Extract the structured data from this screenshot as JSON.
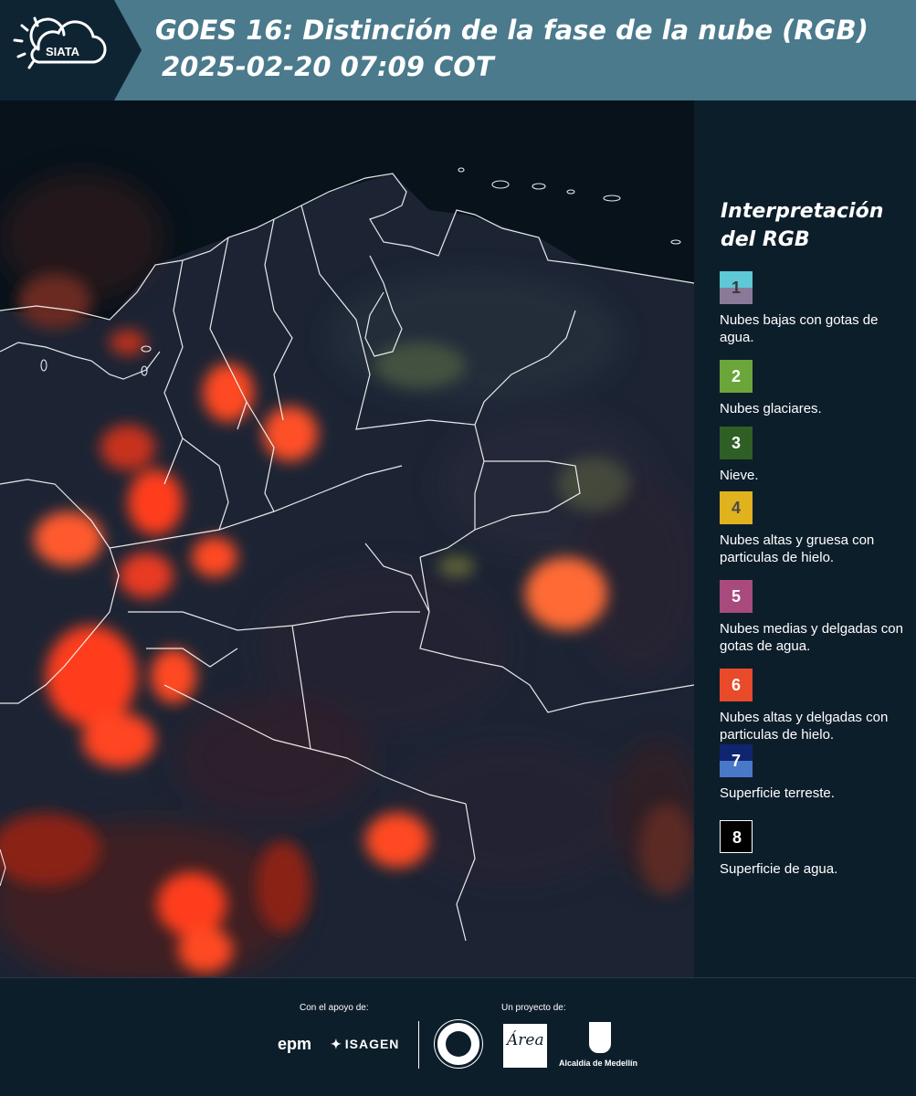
{
  "header": {
    "logo_text": "SIATA",
    "title_line1": "GOES 16: Distinción de la fase de la nube (RGB)",
    "title_line2": "2025-02-20 07:09 COT"
  },
  "legend": {
    "title_line1": "Interpretación",
    "title_line2": "del RGB",
    "items": [
      {
        "number": "1",
        "label": "Nubes bajas con gotas de agua.",
        "color_top": "#5ec8d6",
        "color_bottom": "#8a7a9a",
        "text_color": "#3a3a3a"
      },
      {
        "number": "2",
        "label": "Nubes glaciares.",
        "color_top": "#6aa63a",
        "color_bottom": "#6aa63a",
        "text_color": "#ffffff"
      },
      {
        "number": "3",
        "label": "Nieve.",
        "color_top": "#2f5f24",
        "color_bottom": "#2f5f24",
        "text_color": "#ffffff"
      },
      {
        "number": "4",
        "label": "Nubes altas y gruesa con particulas de hielo.",
        "color_top": "#e0b21e",
        "color_bottom": "#e0b21e",
        "text_color": "#4a4a4a"
      },
      {
        "number": "5",
        "label": "Nubes medias y delgadas con gotas de agua.",
        "color_top": "#a84a7e",
        "color_bottom": "#a84a7e",
        "text_color": "#ffffff"
      },
      {
        "number": "6",
        "label": "Nubes altas y delgadas con particulas de hielo.",
        "color_top": "#e84a2a",
        "color_bottom": "#e84a2a",
        "text_color": "#ffffff"
      },
      {
        "number": "7",
        "label": "Superficie terreste.",
        "color_top": "#0f2570",
        "color_bottom": "#4a78c8",
        "text_color": "#ffffff"
      },
      {
        "number": "8",
        "label": "Superficie de agua.",
        "color_top": "#000000",
        "color_bottom": "#000000",
        "text_color": "#ffffff"
      }
    ]
  },
  "footer": {
    "support_label": "Con el apoyo de:",
    "project_label": "Un proyecto de:",
    "epm_text": "epm",
    "isagen_text": "ISAGEN",
    "area_text": "Área",
    "alcaldia_text": "Alcaldía de Medellín"
  },
  "colors": {
    "header_bg": "#4a7a8c",
    "panel_bg": "#0d1e2b",
    "cloud_ice": "#ff3a1e",
    "land": "#1c2434",
    "water": "#07121a"
  }
}
